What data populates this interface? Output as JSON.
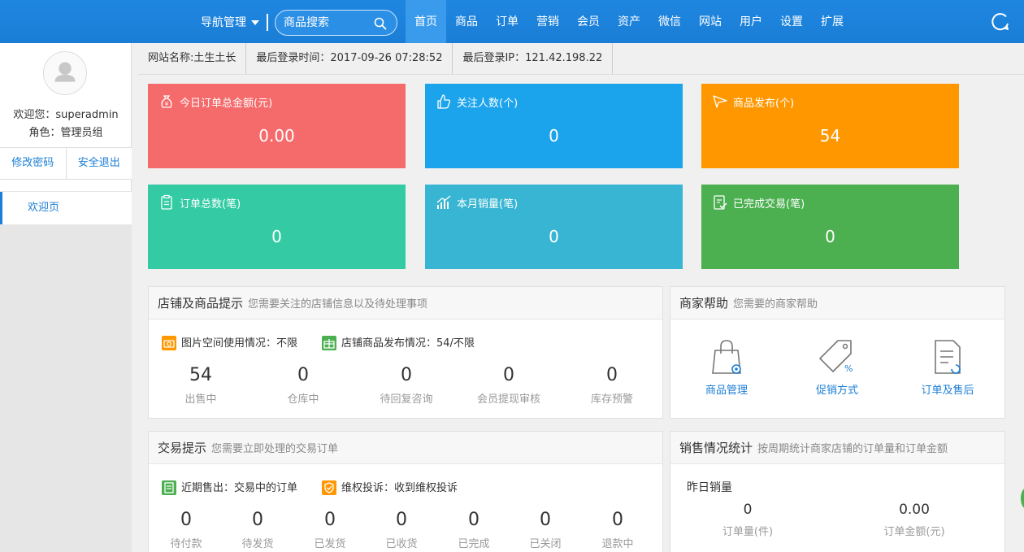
{
  "topbar": {
    "nav_manage": "导航管理",
    "search_placeholder": "商品搜索",
    "menu": [
      "首页",
      "商品",
      "订单",
      "营销",
      "会员",
      "资产",
      "微信",
      "网站",
      "用户",
      "设置",
      "扩展"
    ],
    "active": "首页"
  },
  "sidebar": {
    "welcome": "欢迎您：superadmin",
    "role": "角色：管理员组",
    "change_password": "修改密码",
    "logout": "安全退出",
    "nav_welcome": "欢迎页"
  },
  "infobar": {
    "site_name": "网站名称:土生土长",
    "last_login_time": "最后登录时间：2017-09-26 07:28:52",
    "last_login_ip": "最后登录IP：121.42.198.22"
  },
  "cards": [
    {
      "title": "今日订单总金额(元)",
      "value": "0.00",
      "color": "#f56a6a",
      "icon": "money-bag-icon"
    },
    {
      "title": "关注人数(个)",
      "value": "0",
      "color": "#1ba3ec",
      "icon": "thumbs-up-icon"
    },
    {
      "title": "商品发布(个)",
      "value": "54",
      "color": "#ff9800",
      "icon": "paper-plane-icon"
    },
    {
      "title": "订单总数(笔)",
      "value": "0",
      "color": "#34cba4",
      "icon": "clipboard-icon"
    },
    {
      "title": "本月销量(笔)",
      "value": "0",
      "color": "#38b5d2",
      "icon": "bar-chart-icon"
    },
    {
      "title": "已完成交易(笔)",
      "value": "0",
      "color": "#4caf50",
      "icon": "checklist-icon"
    }
  ],
  "store_panel": {
    "title": "店铺及商品提示",
    "subtitle": "您需要关注的店铺信息以及待处理事项",
    "tip1": "图片空间使用情况：不限",
    "tip2": "店铺商品发布情况：54/不限",
    "counts": [
      {
        "n": "54",
        "l": "出售中"
      },
      {
        "n": "0",
        "l": "仓库中"
      },
      {
        "n": "0",
        "l": "待回复咨询"
      },
      {
        "n": "0",
        "l": "会员提现审核"
      },
      {
        "n": "0",
        "l": "库存预警"
      }
    ]
  },
  "help_panel": {
    "title": "商家帮助",
    "subtitle": "您需要的商家帮助",
    "items": [
      "商品管理",
      "促销方式",
      "订单及售后"
    ]
  },
  "trade_panel": {
    "title": "交易提示",
    "subtitle": "您需要立即处理的交易订单",
    "tip1": "近期售出：交易中的订单",
    "tip2": "维权投诉：收到维权投诉",
    "counts": [
      {
        "n": "0",
        "l": "待付款"
      },
      {
        "n": "0",
        "l": "待发货"
      },
      {
        "n": "0",
        "l": "已发货"
      },
      {
        "n": "0",
        "l": "已收货"
      },
      {
        "n": "0",
        "l": "已完成"
      },
      {
        "n": "0",
        "l": "已关闭"
      },
      {
        "n": "0",
        "l": "退款中"
      }
    ]
  },
  "sales_panel": {
    "title": "销售情况统计",
    "subtitle": "按周期统计商家店铺的订单量和订单金额",
    "yesterday": "昨日销量",
    "order_qty": "0",
    "order_qty_label": "订单量(件)",
    "order_amount": "0.00",
    "order_amount_label": "订单金额(元)"
  }
}
